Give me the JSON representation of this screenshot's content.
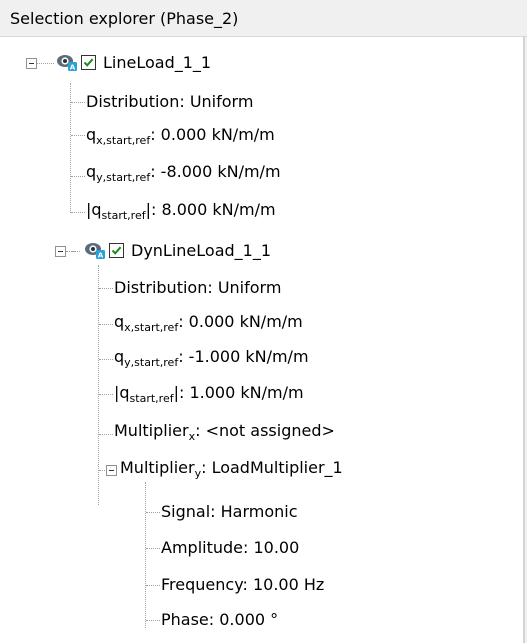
{
  "panel": {
    "title": "Selection explorer (Phase_2)"
  },
  "tree": {
    "line_load": {
      "label": "LineLoad_1_1",
      "checked": true,
      "distribution": "Distribution: Uniform",
      "qx": {
        "symbol": "q",
        "sub": "x,start,ref",
        "value": ": 0.000 kN/m/m"
      },
      "qy": {
        "symbol": "q",
        "sub": "y,start,ref",
        "value": ": -8.000 kN/m/m"
      },
      "qabs": {
        "prefix": "|q",
        "sub": "start,ref",
        "value": "|: 8.000 kN/m/m"
      }
    },
    "dyn_line_load": {
      "label": "DynLineLoad_1_1",
      "checked": true,
      "distribution": "Distribution: Uniform",
      "qx": {
        "symbol": "q",
        "sub": "x,start,ref",
        "value": ": 0.000 kN/m/m"
      },
      "qy": {
        "symbol": "q",
        "sub": "y,start,ref",
        "value": ": -1.000 kN/m/m"
      },
      "qabs": {
        "prefix": "|q",
        "sub": "start,ref",
        "value": "|: 1.000 kN/m/m"
      },
      "multiplier_x": {
        "prefix": "Multiplier",
        "sub": "x",
        "value": ": <not assigned>"
      },
      "multiplier_y": {
        "prefix": "Multiplier",
        "sub": "y",
        "value": ": LoadMultiplier_1"
      },
      "signal": "Signal: Harmonic",
      "amplitude": "Amplitude: 10.00",
      "frequency": "Frequency: 10.00 Hz",
      "phase": "Phase: 0.000 °"
    }
  },
  "colors": {
    "eye_icon": "#5a6b7a",
    "eye_badge": "#2a9fd8",
    "check": "#1a8a1a",
    "tree_lines": "#a0a0a0"
  }
}
